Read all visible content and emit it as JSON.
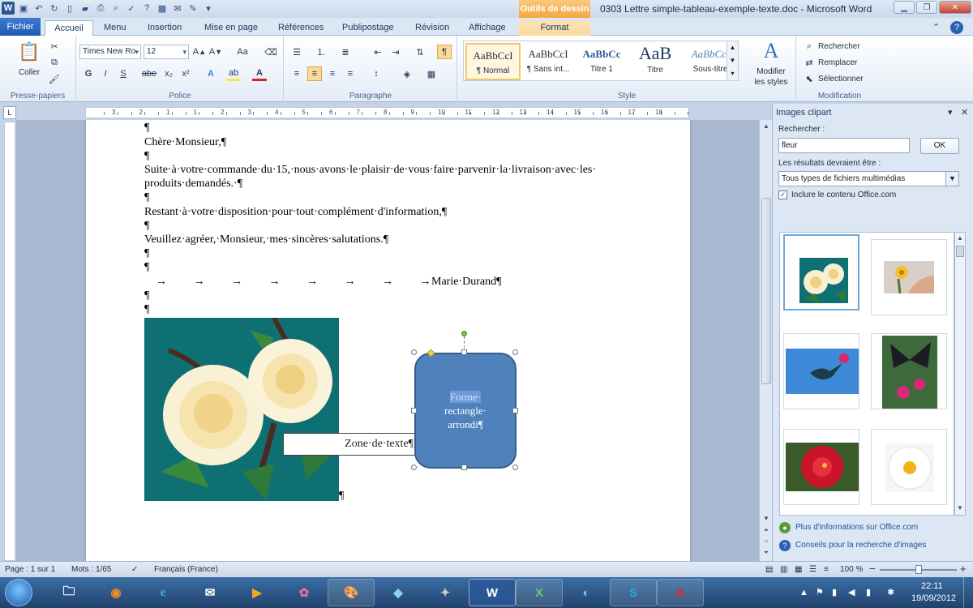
{
  "window": {
    "title": "0303 Lettre simple-tableau-exemple-texte.doc - Microsoft Word",
    "context_tab_group": "Outils de dessin",
    "app_icon": "word-icon"
  },
  "tabs": [
    "Fichier",
    "Accueil",
    "Menu",
    "Insertion",
    "Mise en page",
    "Références",
    "Publipostage",
    "Révision",
    "Affichage",
    "Format"
  ],
  "ribbon": {
    "clipboard": {
      "paste": "Coller",
      "group": "Presse-papiers"
    },
    "font": {
      "name": "Times New Ro",
      "size": "12",
      "group": "Police",
      "bold": "G",
      "italic": "I",
      "underline": "S",
      "strike": "abe",
      "subscript": "x₂",
      "superscript": "x²",
      "change_case": "Aa"
    },
    "paragraph": {
      "group": "Paragraphe"
    },
    "styles": {
      "group": "Style",
      "items": [
        {
          "sample": "AaBbCcI",
          "name": "¶ Normal"
        },
        {
          "sample": "AaBbCcI",
          "name": "¶ Sans int..."
        },
        {
          "sample": "AaBbCc",
          "name": "Titre 1"
        },
        {
          "sample": "AaB",
          "name": "Titre"
        },
        {
          "sample": "AaBbCc.",
          "name": "Sous-titre"
        }
      ],
      "modify_line1": "Modifier",
      "modify_line2": "les styles"
    },
    "editing": {
      "group": "Modification",
      "find": "Rechercher",
      "replace": "Remplacer",
      "select": "Sélectionner"
    }
  },
  "ruler_numbers": [
    "3",
    "2",
    "1",
    "1",
    "2",
    "3",
    "4",
    "5",
    "6",
    "7",
    "8",
    "9",
    "10",
    "11",
    "12",
    "13",
    "14",
    "15",
    "16",
    "17",
    "18"
  ],
  "document": {
    "lines": [
      "¶",
      "Chère·Monsieur,¶",
      "¶",
      "Suite·à·votre·commande·du·15,·nous·avons·le·plaisir·de·vous·faire·parvenir·la·livraison·avec·les·",
      "produits·demandés.·¶",
      "¶",
      "Restant·à·votre·disposition·pour·tout·complément·d'information,¶",
      "¶",
      "Veuillez·agréer,·Monsieur,·mes·sincères·salutations.¶",
      "¶",
      "¶"
    ],
    "signature": "Marie·Durand¶",
    "after_signature": [
      "¶",
      "¶"
    ],
    "image_pilcrow": "¶",
    "textbox": "Zone·de·texte¶",
    "shape_line1": "Forme·",
    "shape_line2": "rectangle·",
    "shape_line3": "arrondi¶"
  },
  "clipart_pane": {
    "title": "Images clipart",
    "search_label": "Rechercher :",
    "search_value": "fleur",
    "ok": "OK",
    "results_label": "Les résultats devraient être :",
    "results_value": "Tous types de fichiers multimédias",
    "include_label": "Inclure le contenu Office.com",
    "include_checked": true,
    "thumbnails": [
      "white-roses-clipart",
      "yellow-flower-hand-photo",
      "hummingbird-photo",
      "butterfly-photo",
      "red-rose-photo",
      "daisy-photo"
    ],
    "link1": "Plus d'informations sur Office.com",
    "link2": "Conseils pour la recherche d'images"
  },
  "statusbar": {
    "page": "Page : 1 sur 1",
    "words": "Mots : 1/65",
    "language": "Français (France)",
    "zoom": "100 %",
    "zoom_minus": "−",
    "zoom_plus": "+"
  },
  "taskbar": {
    "apps": [
      "explorer",
      "firefox",
      "internet-explorer",
      "mail",
      "media",
      "paint",
      "office",
      "notes",
      "gimp",
      "word",
      "excel",
      "thunderbird",
      "skype",
      "acrobat"
    ],
    "time": "22:11",
    "date": "19/09/2012"
  }
}
